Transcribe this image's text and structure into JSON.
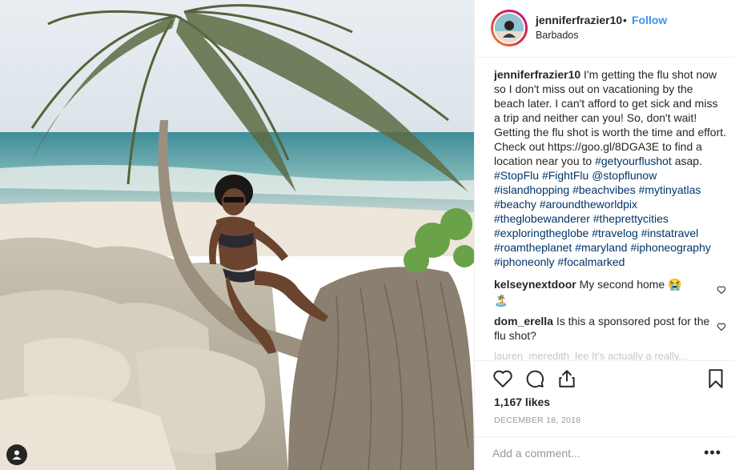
{
  "post": {
    "username": "jenniferfrazier10",
    "separator": "•",
    "follow_label": "Follow",
    "location": "Barbados",
    "photo_alt": "Woman in a bikini and sunglasses sitting on a leaning palm tree trunk on rocky beach"
  },
  "caption": {
    "username": "jenniferfrazier10",
    "text": " I'm getting the flu shot now so I don't miss out on vacationing by the beach later. I can't afford to get sick and miss a trip and neither can you! So, don't wait! Getting the flu shot is worth the time and effort. Check out https://goo.gl/8DGA3E to find a location near you to ",
    "tags": [
      "#getyourflushot",
      " asap. ",
      "#StopFlu",
      " ",
      "#FightFlu",
      " ",
      "@stopflunow",
      " ",
      "#islandhopping",
      " ",
      "#beachvibes",
      " ",
      "#mytinyatlas",
      " ",
      "#beachy",
      " ",
      "#aroundtheworldpix",
      " ",
      "#theglobewanderer",
      " ",
      "#theprettycities",
      " ",
      "#exploringtheglobe",
      " ",
      "#travelog",
      " ",
      "#instatravel",
      " ",
      "#roamtheplanet",
      " ",
      "#maryland",
      " ",
      "#iphoneography",
      " ",
      "#iphoneonly",
      " ",
      "#focalmarked"
    ]
  },
  "comments": [
    {
      "username": "kelseynextdoor",
      "text": " My second home 😭",
      "emoji_line": "🏝️"
    },
    {
      "username": "dom_erella",
      "text": " Is this a sponsored post for the flu shot?"
    }
  ],
  "faded_comment": "lauren_meredith_lee It's actually a really...",
  "likes": "1,167 likes",
  "date": "DECEMBER 18, 2018",
  "add_comment_placeholder": "Add a comment...",
  "more_label": "•••",
  "icons": {
    "like": "heart-icon",
    "comment": "comment-bubble-icon",
    "share": "share-icon",
    "save": "bookmark-icon",
    "user": "user-tag-icon"
  },
  "colors": {
    "link": "#003569",
    "follow": "#3897f0",
    "text": "#262626",
    "muted": "#999999"
  }
}
